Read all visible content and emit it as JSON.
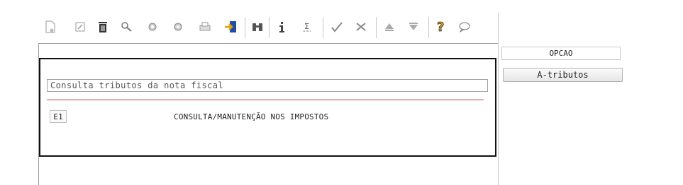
{
  "toolbar": {
    "icons": [
      "new-icon",
      "edit-icon",
      "trash-icon",
      "search-icon",
      "circle-icon",
      "circle-icon",
      "print-icon",
      "exit-icon",
      "binoculars-icon",
      "info-icon",
      "sum-icon",
      "check-icon",
      "cancel-icon",
      "up-icon",
      "down-icon",
      "help-icon",
      "comment-icon"
    ]
  },
  "form": {
    "title": "Consulta tributos da nota fiscal",
    "entry_code": "E1",
    "entry_description": "CONSULTA/MANUTENÇÃO NOS IMPOSTOS"
  },
  "options": {
    "header": "OPCAO",
    "button_label": "A-tributos"
  }
}
